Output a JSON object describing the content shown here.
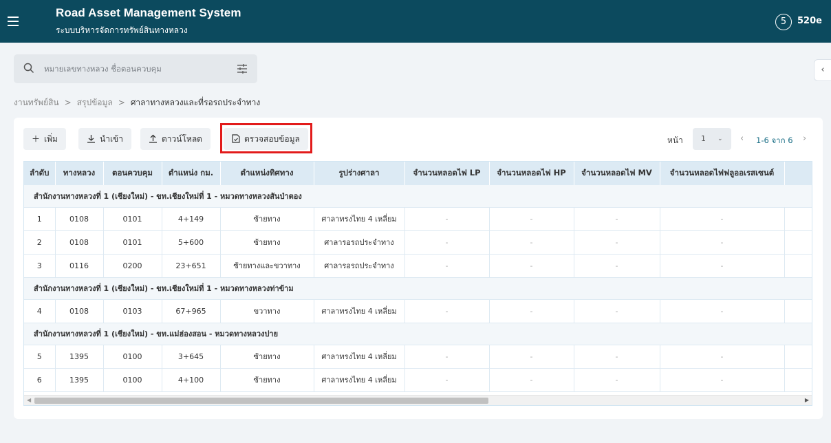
{
  "header": {
    "title": "Road Asset Management System",
    "subtitle": "ระบบบริหารจัดการทรัพย์สินทางหลวง",
    "user_badge": "5",
    "user_code": "520e"
  },
  "search": {
    "placeholder": "หมายเลขทางหลวง ชื่อตอนควบคุม"
  },
  "breadcrumb": [
    "งานทรัพย์สิน",
    "สรุปข้อมูล",
    "ศาลาทางหลวงและที่รอรถประจำทาง"
  ],
  "toolbar": {
    "add_label": "เพิ่ม",
    "import_label": "นำเข้า",
    "download_label": "ดาวน์โหลด",
    "verify_label": "ตรวจสอบข้อมูล"
  },
  "pager": {
    "label": "หน้า",
    "page": "1",
    "range": "1-6 จาก 6"
  },
  "table": {
    "columns": [
      "ลำดับ",
      "ทางหลวง",
      "ตอนควบคุม",
      "ตำแหน่ง กม.",
      "ตำแหน่งทิศทาง",
      "รูปร่างศาลา",
      "จำนวนหลอดไฟ LP",
      "จำนวนหลอดไฟ HP",
      "จำนวนหลอดไฟ MV",
      "จำนวนหลอดไฟฟลูออเรสเซนต์"
    ],
    "groups": [
      {
        "title": "สำนักงานทางหลวงที่ 1 (เชียงใหม่) - ขท.เชียงใหม่ที่ 1 - หมวดทางหลวงสันป่าตอง",
        "rows": [
          [
            "1",
            "0108",
            "0101",
            "4+149",
            "ซ้ายทาง",
            "ศาลาทรงไทย 4 เหลี่ยม",
            "-",
            "-",
            "-",
            "-"
          ],
          [
            "2",
            "0108",
            "0101",
            "5+600",
            "ซ้ายทาง",
            "ศาลารอรถประจำทาง",
            "-",
            "-",
            "-",
            "-"
          ],
          [
            "3",
            "0116",
            "0200",
            "23+651",
            "ซ้ายทางและขวาทาง",
            "ศาลารอรถประจำทาง",
            "-",
            "-",
            "-",
            "-"
          ]
        ]
      },
      {
        "title": "สำนักงานทางหลวงที่ 1 (เชียงใหม่) - ขท.เชียงใหม่ที่ 1 - หมวดทางหลวงท่าข้าม",
        "rows": [
          [
            "4",
            "0108",
            "0103",
            "67+965",
            "ขวาทาง",
            "ศาลาทรงไทย 4 เหลี่ยม",
            "-",
            "-",
            "-",
            "-"
          ]
        ]
      },
      {
        "title": "สำนักงานทางหลวงที่ 1 (เชียงใหม่) - ขท.แม่ฮ่องสอน - หมวดทางหลวงปาย",
        "rows": [
          [
            "5",
            "1395",
            "0100",
            "3+645",
            "ซ้ายทาง",
            "ศาลาทรงไทย 4 เหลี่ยม",
            "-",
            "-",
            "-",
            "-"
          ],
          [
            "6",
            "1395",
            "0100",
            "4+100",
            "ซ้ายทาง",
            "ศาลาทรงไทย 4 เหลี่ยม",
            "-",
            "-",
            "-",
            "-"
          ]
        ]
      }
    ]
  },
  "colors": {
    "header_bg": "#0c4a5e",
    "table_header_bg": "#dceaf4",
    "highlight": "#e21b1b",
    "link": "#1a6e86"
  }
}
